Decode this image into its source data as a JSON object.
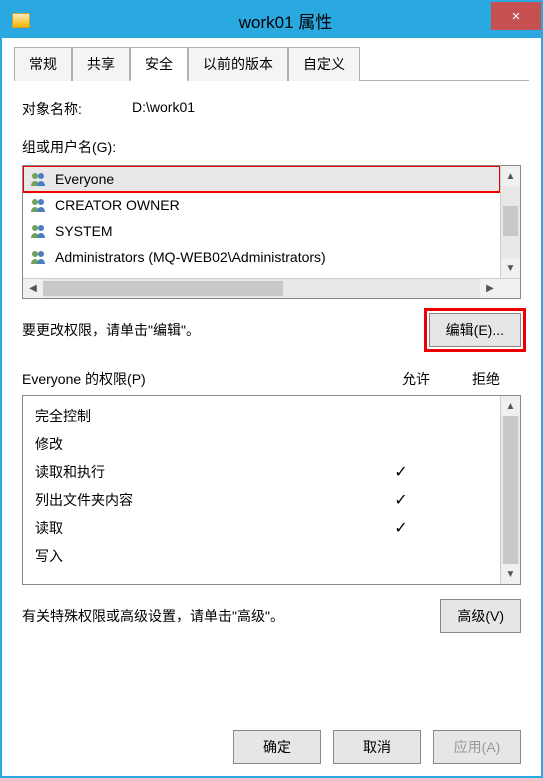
{
  "titlebar": {
    "title": "work01 属性",
    "close_icon": "×"
  },
  "tabs": [
    {
      "label": "常规",
      "active": false
    },
    {
      "label": "共享",
      "active": false
    },
    {
      "label": "安全",
      "active": true
    },
    {
      "label": "以前的版本",
      "active": false
    },
    {
      "label": "自定义",
      "active": false
    }
  ],
  "object": {
    "label": "对象名称:",
    "value": "D:\\work01"
  },
  "groups": {
    "label": "组或用户名(G):",
    "items": [
      {
        "name": "Everyone",
        "selected": true
      },
      {
        "name": "CREATOR OWNER",
        "selected": false
      },
      {
        "name": "SYSTEM",
        "selected": false
      },
      {
        "name": "Administrators (MQ-WEB02\\Administrators)",
        "selected": false
      }
    ]
  },
  "edit": {
    "text": "要更改权限，请单击\"编辑\"。",
    "button": "编辑(E)..."
  },
  "permissions": {
    "label": "Everyone 的权限(P)",
    "col_allow": "允许",
    "col_deny": "拒绝",
    "items": [
      {
        "name": "完全控制",
        "allow": false,
        "deny": false
      },
      {
        "name": "修改",
        "allow": false,
        "deny": false
      },
      {
        "name": "读取和执行",
        "allow": true,
        "deny": false
      },
      {
        "name": "列出文件夹内容",
        "allow": true,
        "deny": false
      },
      {
        "name": "读取",
        "allow": true,
        "deny": false
      },
      {
        "name": "写入",
        "allow": false,
        "deny": false
      }
    ]
  },
  "advanced": {
    "text": "有关特殊权限或高级设置，请单击\"高级\"。",
    "button": "高级(V)"
  },
  "footer": {
    "ok": "确定",
    "cancel": "取消",
    "apply": "应用(A)"
  }
}
